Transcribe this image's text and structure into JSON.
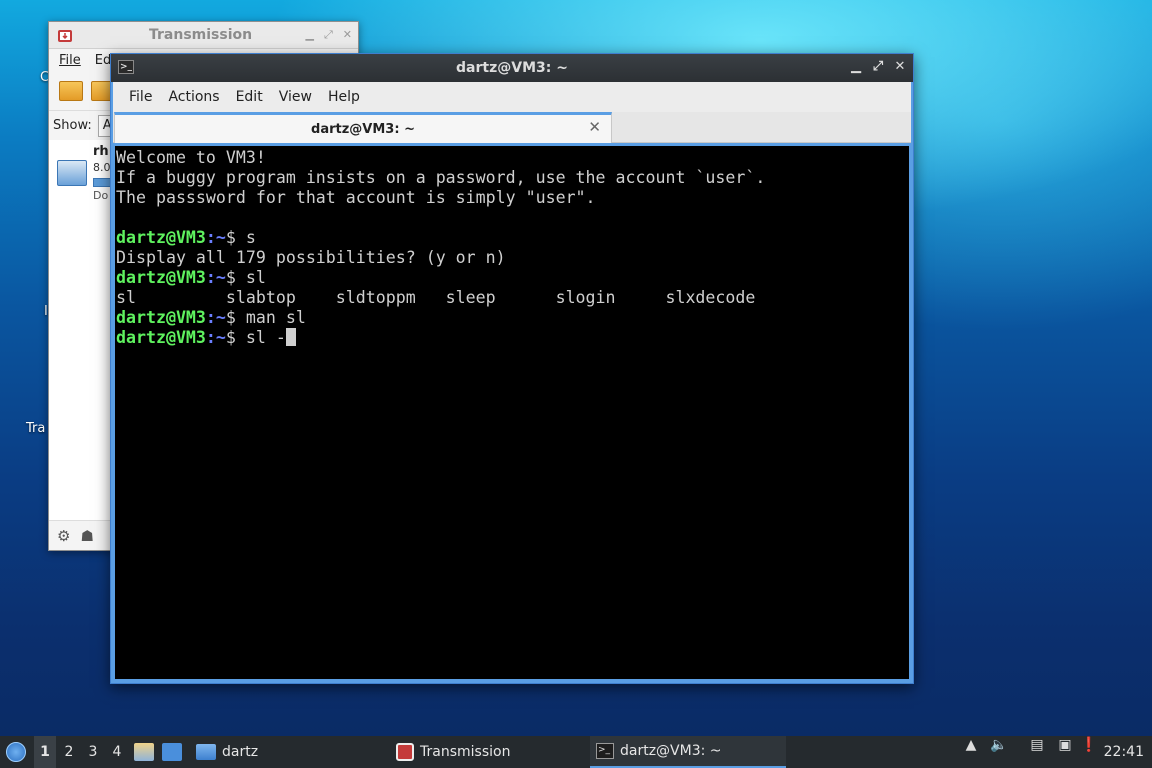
{
  "desktop": {
    "labels": [
      "C",
      "I",
      "Tra"
    ]
  },
  "transmission": {
    "title": "Transmission",
    "menu": [
      "File",
      "Ed"
    ],
    "filter_label": "Show:",
    "filter_value": "A",
    "torrent": {
      "name": "rh",
      "size": "8.0",
      "status": "Do"
    }
  },
  "terminal": {
    "title": "dartz@VM3: ~",
    "menu": [
      "File",
      "Actions",
      "Edit",
      "View",
      "Help"
    ],
    "tab_label": "dartz@VM3: ~",
    "lines": [
      {
        "type": "text",
        "text": "Welcome to VM3!"
      },
      {
        "type": "text",
        "text": "If a buggy program insists on a password, use the account `user`."
      },
      {
        "type": "text",
        "text": "The passsword for that account is simply \"user\"."
      },
      {
        "type": "text",
        "text": ""
      },
      {
        "type": "prompt",
        "user": "dartz@VM3",
        "path": ":~",
        "cmd": "$ s"
      },
      {
        "type": "text",
        "text": "Display all 179 possibilities? (y or n)"
      },
      {
        "type": "prompt",
        "user": "dartz@VM3",
        "path": ":~",
        "cmd": "$ sl"
      },
      {
        "type": "text",
        "text": "sl         slabtop    sldtoppm   sleep      slogin     slxdecode"
      },
      {
        "type": "prompt",
        "user": "dartz@VM3",
        "path": ":~",
        "cmd": "$ man sl"
      },
      {
        "type": "prompt",
        "user": "dartz@VM3",
        "path": ":~",
        "cmd": "$ sl -",
        "cursor": true
      }
    ]
  },
  "taskbar": {
    "workspaces": [
      "1",
      "2",
      "3",
      "4"
    ],
    "active_workspace": "1",
    "tasks": [
      {
        "label": "dartz",
        "icon": "folder-icon"
      },
      {
        "label": "Transmission",
        "icon": "transmission-icon"
      },
      {
        "label": "dartz@VM3: ~",
        "icon": "terminal-icon",
        "active": true
      }
    ],
    "clock": "22:41"
  },
  "colors": {
    "prompt_user": "#5ff25f",
    "prompt_path": "#6b7fff",
    "accent": "#5a9ee4",
    "terminal_bg": "#000000"
  }
}
